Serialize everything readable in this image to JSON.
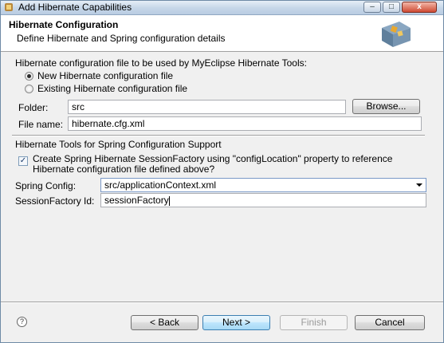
{
  "window": {
    "title": "Add Hibernate Capabilities",
    "title_icon": "hibernate-app-icon",
    "controls": {
      "minimize": "–",
      "maximize": "□",
      "close": "x"
    }
  },
  "header": {
    "title": "Hibernate Configuration",
    "description": "Define Hibernate and Spring configuration details",
    "image": "wizard-banner-icon"
  },
  "config_file": {
    "section_label": "Hibernate configuration file to be used by MyEclipse Hibernate Tools:",
    "options": [
      {
        "label": "New Hibernate configuration file",
        "selected": true
      },
      {
        "label": "Existing Hibernate configuration file",
        "selected": false
      }
    ],
    "folder_label": "Folder:",
    "folder_value": "src",
    "browse_label": "Browse...",
    "filename_label": "File name:",
    "filename_value": "hibernate.cfg.xml"
  },
  "spring": {
    "section_label": "Hibernate Tools for Spring Configuration Support",
    "checkbox_line1": "Create Spring Hibernate SessionFactory using \"configLocation\" property to reference",
    "checkbox_line2": "Hibernate configuration file defined above?",
    "checkbox_checked": true,
    "spring_config_label": "Spring Config:",
    "spring_config_value": "src/applicationContext.xml",
    "session_factory_label": "SessionFactory Id:",
    "session_factory_value": "sessionFactory"
  },
  "footer": {
    "help_icon": "help-icon",
    "help_glyph": "?",
    "back_label": "< Back",
    "next_label": "Next >",
    "finish_label": "Finish",
    "cancel_label": "Cancel"
  }
}
